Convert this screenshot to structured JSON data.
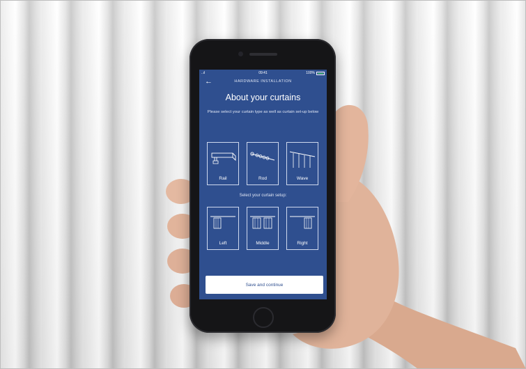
{
  "status_bar": {
    "signal": "..ıl",
    "time": "09:41",
    "battery_text": "100%"
  },
  "header": {
    "back_icon": "back-arrow-icon",
    "title": "HARDWARE INSTALLATION"
  },
  "main": {
    "title": "About your curtains",
    "subtitle": "Please select your curtain type as well as curtain set-up below",
    "curtain_types": [
      {
        "label": "Rail",
        "icon": "rail-icon"
      },
      {
        "label": "Rod",
        "icon": "rod-icon"
      },
      {
        "label": "Wave",
        "icon": "wave-icon"
      }
    ],
    "setup_label": "Select your curtain setup:",
    "curtain_setups": [
      {
        "label": "Left",
        "icon": "left-setup-icon"
      },
      {
        "label": "Middle",
        "icon": "middle-setup-icon"
      },
      {
        "label": "Right",
        "icon": "right-setup-icon"
      }
    ],
    "save_button": "Save and continue"
  },
  "colors": {
    "screen_bg": "#2f4f8f",
    "button_bg": "#ffffff",
    "button_text": "#2f4f8f"
  }
}
